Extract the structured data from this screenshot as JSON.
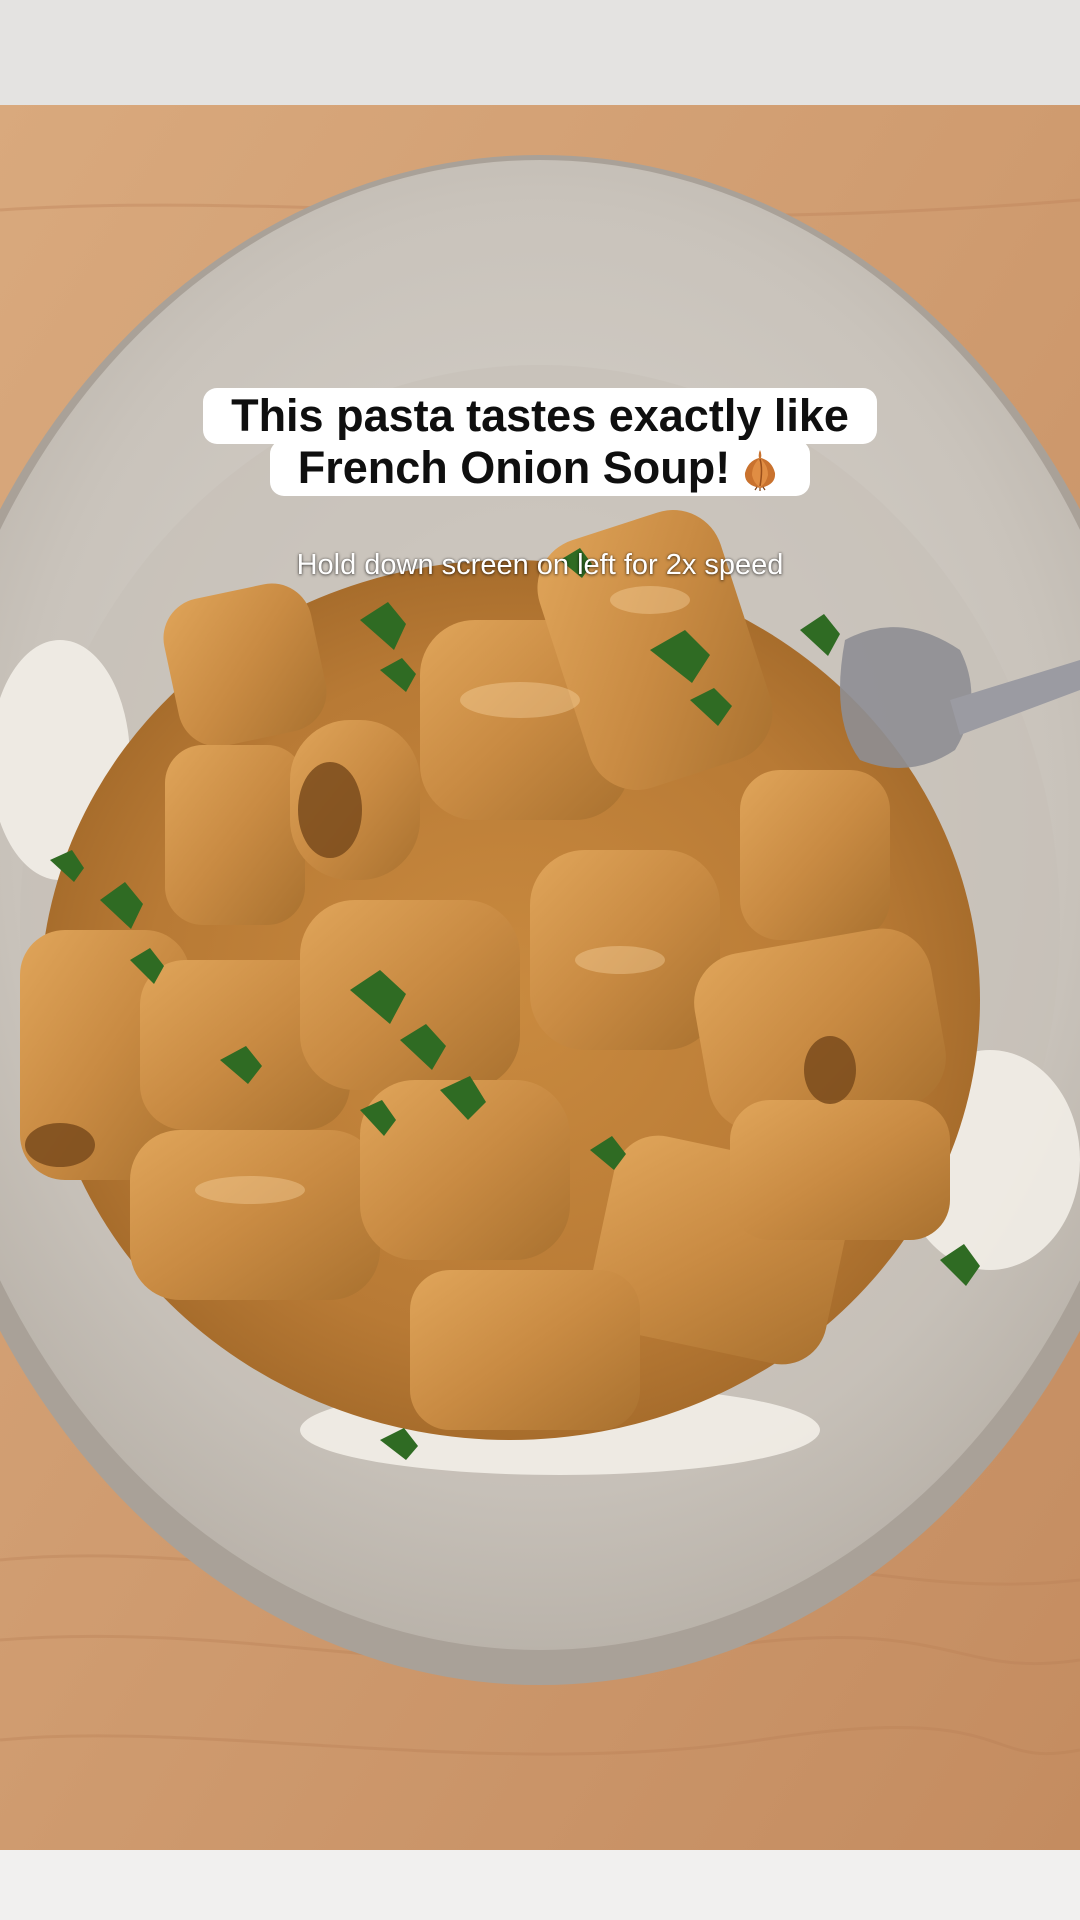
{
  "video": {
    "scene_description_icon": "pasta-dish-image"
  },
  "caption": {
    "line1": "This pasta tastes exactly like",
    "line2": "French Onion Soup!",
    "emoji_icon": "onion-icon"
  },
  "hint": {
    "text": "Hold down screen on left for 2x speed"
  },
  "colors": {
    "caption_bg": "#ffffff",
    "caption_text": "#0f0f0f",
    "hint_text": "#ffffff"
  }
}
